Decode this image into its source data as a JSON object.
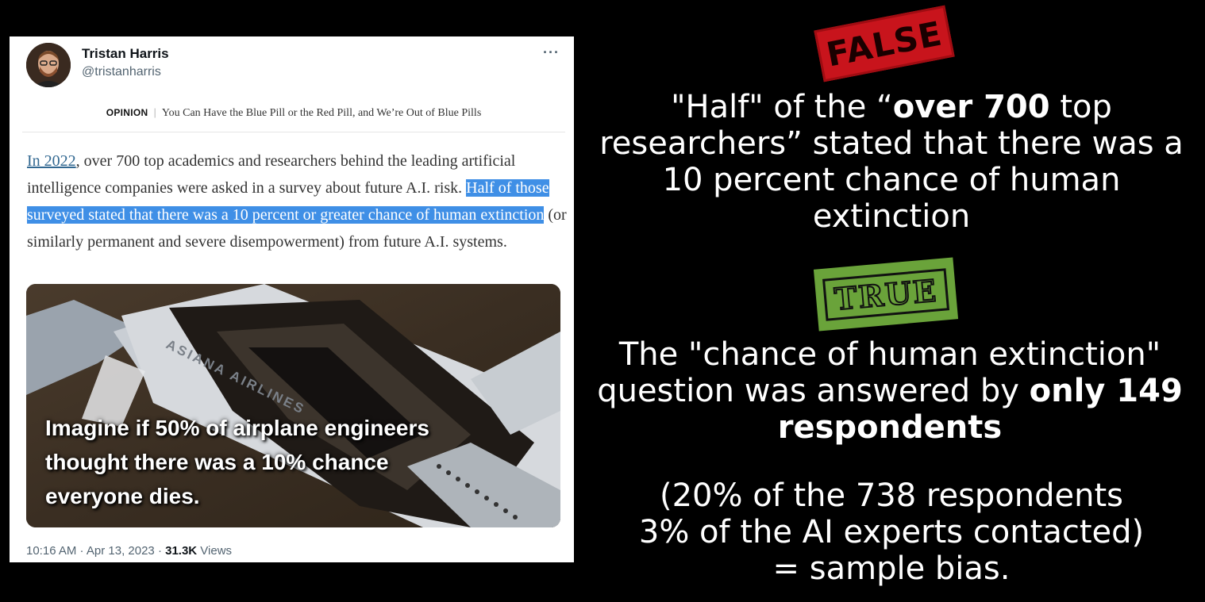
{
  "tweet": {
    "author_name": "Tristan Harris",
    "author_handle": "@tristanharris",
    "more_icon": "more-horizontal-icon",
    "headline": {
      "section": "OPINION",
      "separator": "|",
      "title": "You Can Have the Blue Pill or the Red Pill, and We’re Out of Blue Pills"
    },
    "article": {
      "link_text": "In 2022",
      "text_1": ", over 700 top academics and researchers behind the leading artificial intelligence companies were asked in a survey about future A.I. risk. ",
      "highlighted": "Half of those surveyed stated that there was a 10 percent or greater chance of human extinction",
      "text_2": " (or similarly permanent and severe disempowerment) from future A.I. systems."
    },
    "image_caption": "Imagine if 50% of airplane engineers thought there was a 10% chance everyone dies.",
    "aircraft_livery": "ASIANA AIRLINES",
    "timestamp": "10:16 AM · Apr 13, 2023 · ",
    "views_count": "31.3K",
    "views_label": " Views"
  },
  "stamps": {
    "false_label": "FALSE",
    "true_label": "TRUE",
    "false_color": "#c8141c",
    "true_color": "#6aa33a"
  },
  "commentary": {
    "claim_pre": "\"Half\" of the “",
    "claim_bold": "over 700",
    "claim_post": " top researchers” stated that there was a 10 percent chance of human extinction",
    "fact_pre": "The \"chance of human extinction\" question was answered by ",
    "fact_bold": "only 149 respondents",
    "note_line1": "(20% of the 738 respondents",
    "note_line2": "3% of the AI experts contacted)",
    "note_line3": "= sample bias."
  }
}
